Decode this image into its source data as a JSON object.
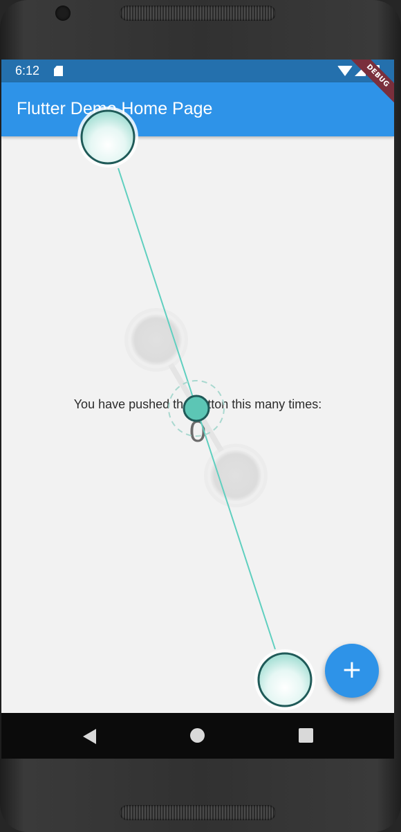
{
  "status_bar": {
    "time": "6:12",
    "icons": [
      "sd-card-icon",
      "wifi-icon",
      "signal-icon",
      "battery-icon"
    ]
  },
  "app_bar": {
    "title": "Flutter Demo Home Page",
    "debug_banner": "DEBUG"
  },
  "main": {
    "message": "You have pushed the button this many times:",
    "counter": "0"
  },
  "fab": {
    "icon": "add-icon",
    "label": "+"
  },
  "nav_bar": {
    "buttons": [
      "back-icon",
      "home-icon",
      "recents-icon"
    ]
  },
  "colors": {
    "app_bar": "#2e93e8",
    "status_bar": "#2470ad",
    "background": "#f2f2f2",
    "touch_line": "#5fcfbf",
    "touch_stroke": "#1f5a58",
    "debug_banner": "#7a2f3c"
  }
}
